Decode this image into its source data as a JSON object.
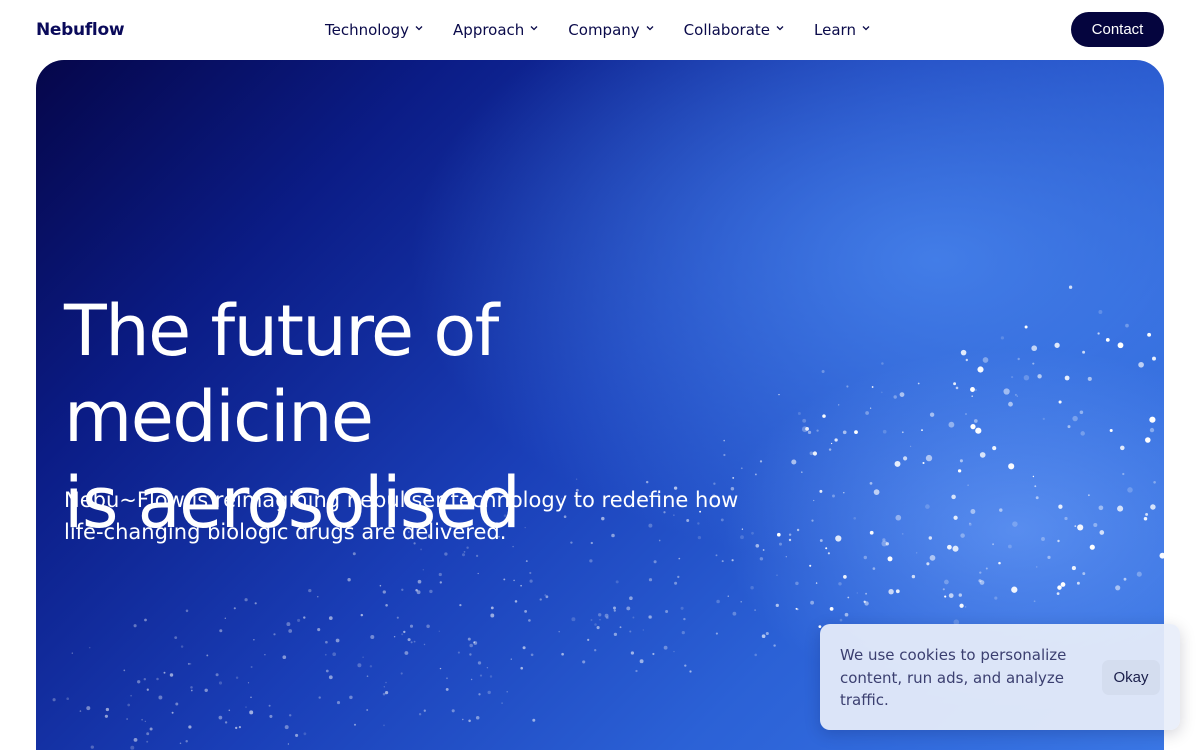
{
  "brand": {
    "logo_text": "Nebuflow",
    "accent_color": "#05053e",
    "logo_accent": "#3a8fe0"
  },
  "nav": {
    "items": [
      {
        "label": "Technology"
      },
      {
        "label": "Approach"
      },
      {
        "label": "Company"
      },
      {
        "label": "Collaborate"
      },
      {
        "label": "Learn"
      }
    ],
    "contact_label": "Contact"
  },
  "hero": {
    "title_line1": "The future of medicine",
    "title_line2": "is aerosolised",
    "subtitle": "Nebu~Flow is reimagining nebuliser technology to redefine how life-changing biologic drugs are delivered."
  },
  "cookie_banner": {
    "text": "We use cookies to personalize content, run ads, and analyze traffic.",
    "button_label": "Okay"
  }
}
